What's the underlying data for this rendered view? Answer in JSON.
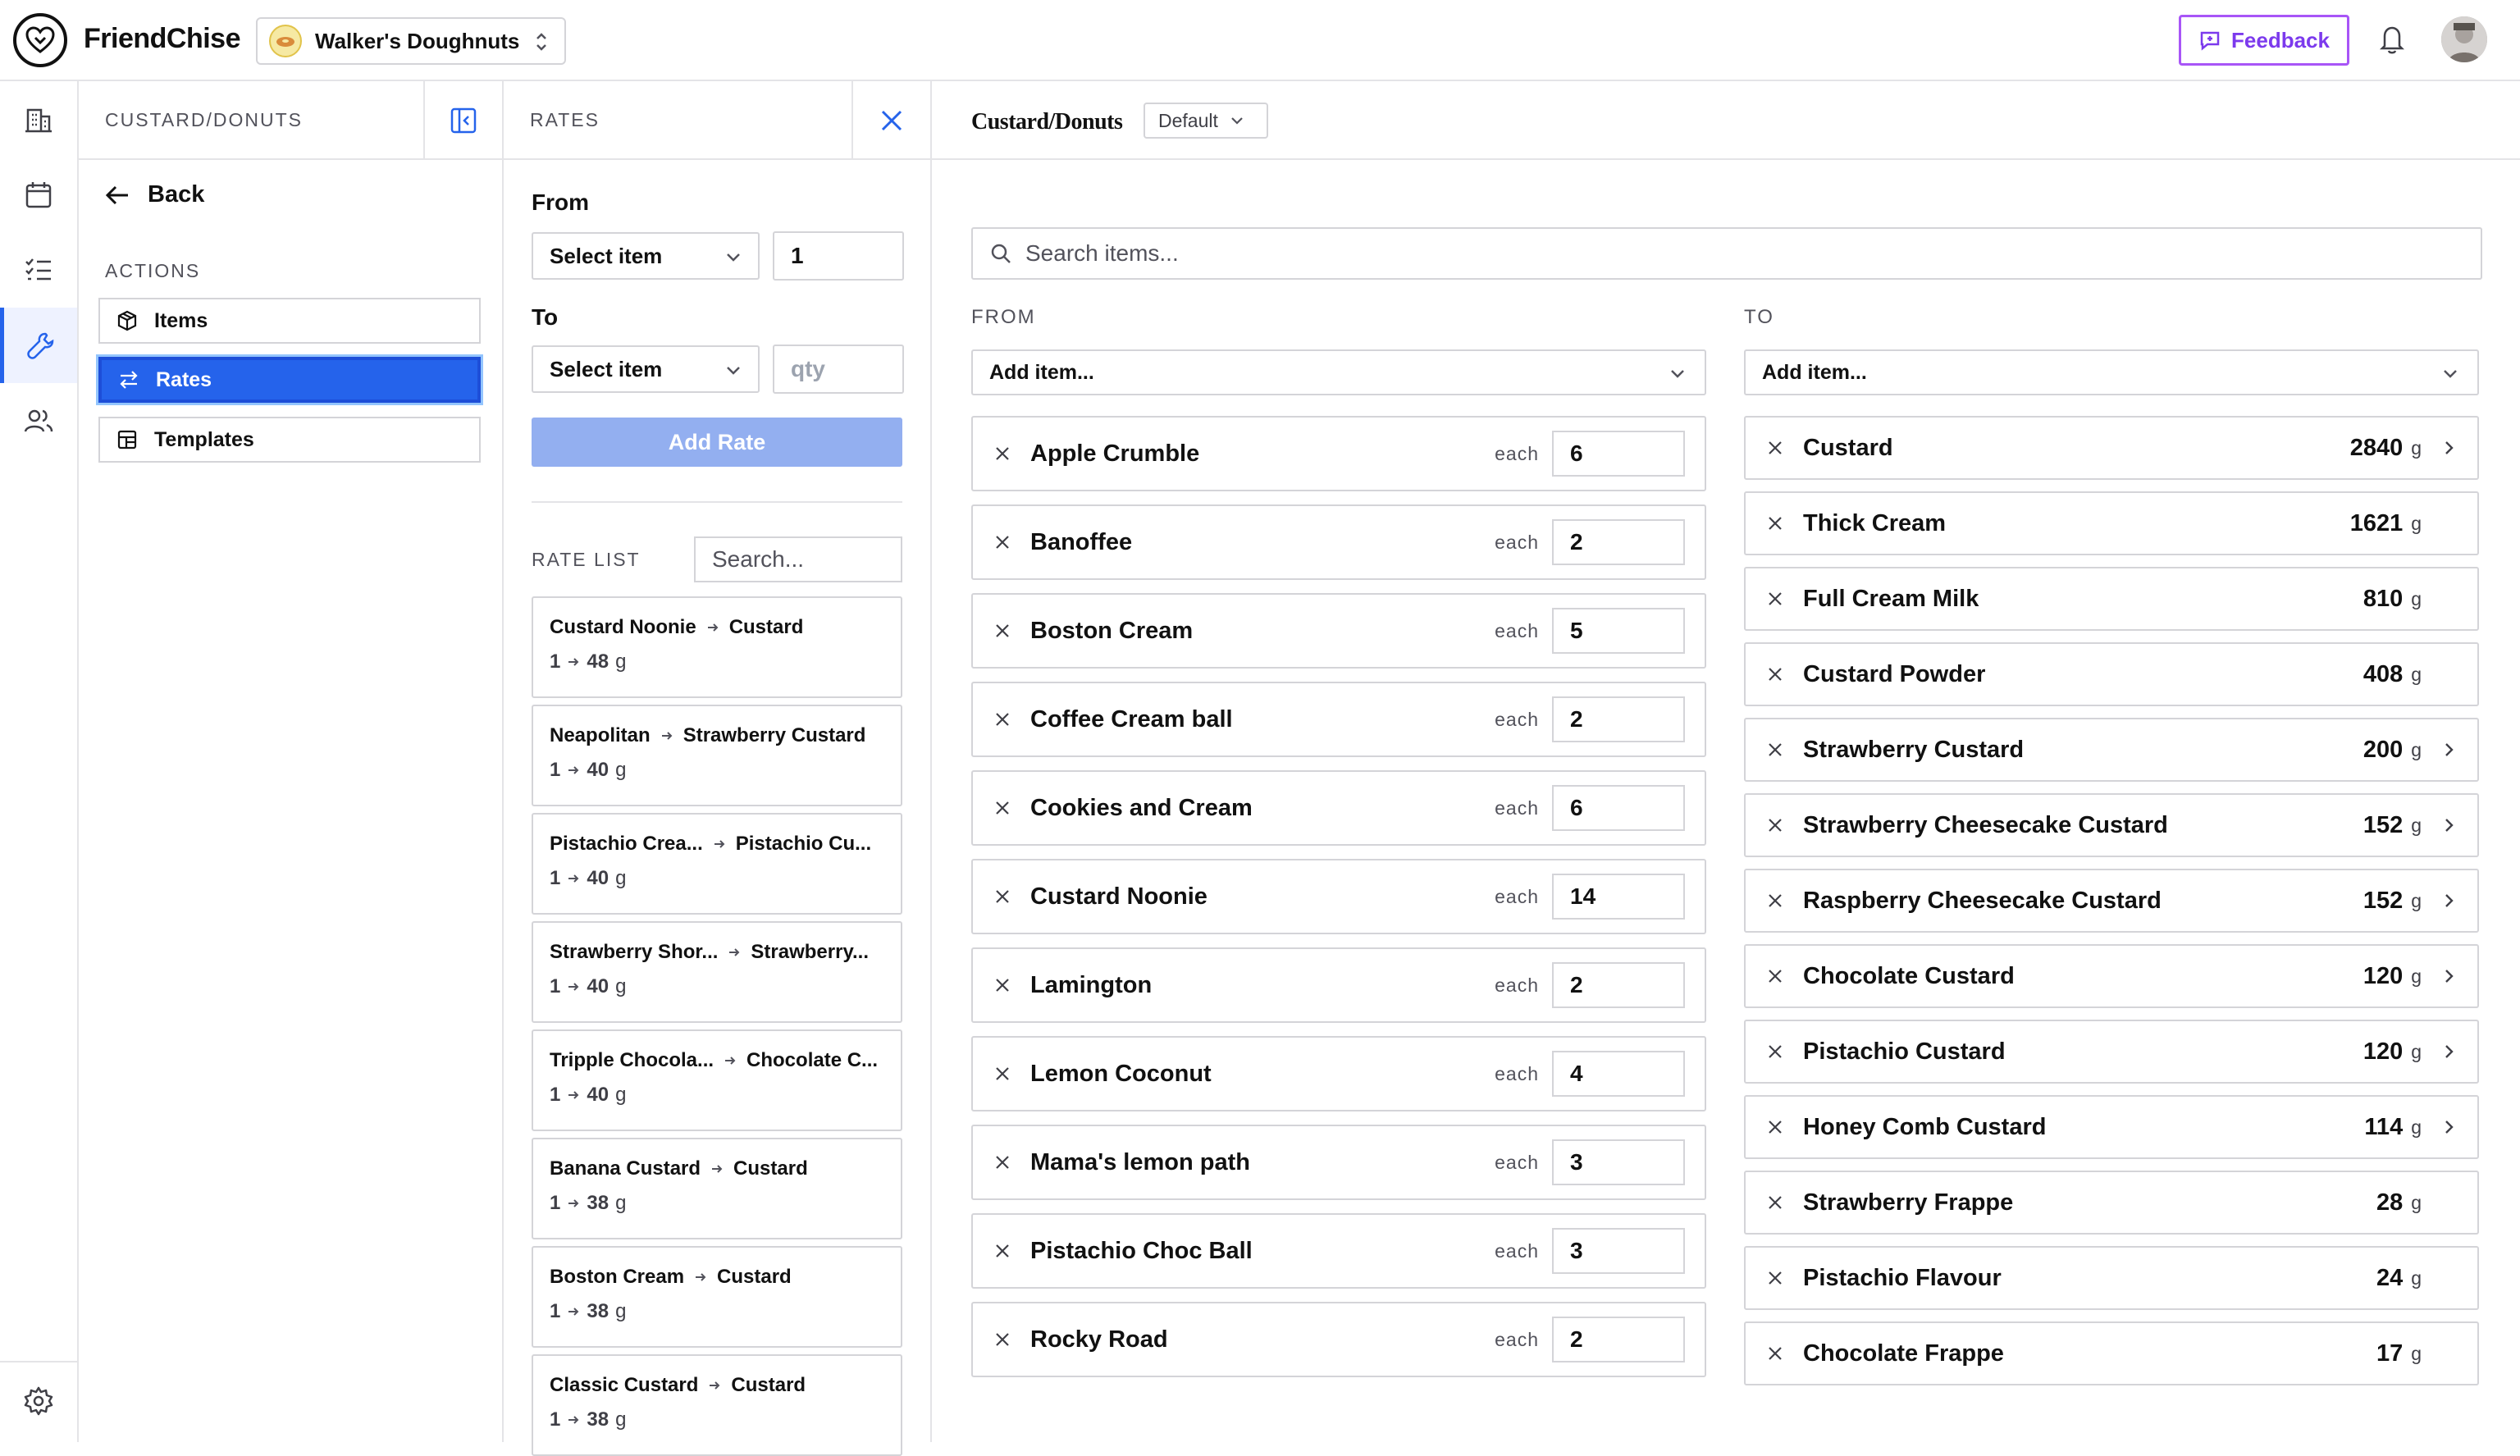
{
  "app": {
    "brand": "FriendChise",
    "store": "Walker's Doughnuts",
    "feedback_label": "Feedback"
  },
  "sidebar": {
    "title": "CUSTARD/DONUTS",
    "back_label": "Back",
    "actions_label": "ACTIONS",
    "actions": [
      {
        "label": "Items",
        "icon": "box-icon",
        "active": false
      },
      {
        "label": "Rates",
        "icon": "swap-icon",
        "active": true
      },
      {
        "label": "Templates",
        "icon": "template-icon",
        "active": false
      }
    ]
  },
  "rates_panel": {
    "title": "RATES",
    "from_label": "From",
    "from_select": "Select item",
    "from_qty": "1",
    "to_label": "To",
    "to_select": "Select item",
    "to_qty_placeholder": "qty",
    "add_rate_label": "Add Rate",
    "rate_list_label": "RATE LIST",
    "rate_search_placeholder": "Search...",
    "rates": [
      {
        "from": "Custard Noonie",
        "to": "Custard",
        "qty": "1",
        "amount": "48",
        "unit": "g"
      },
      {
        "from": "Neapolitan",
        "to": "Strawberry Custard",
        "qty": "1",
        "amount": "40",
        "unit": "g"
      },
      {
        "from": "Pistachio Crea...",
        "to": "Pistachio Cu...",
        "qty": "1",
        "amount": "40",
        "unit": "g"
      },
      {
        "from": "Strawberry Shor...",
        "to": "Strawberry...",
        "qty": "1",
        "amount": "40",
        "unit": "g"
      },
      {
        "from": "Tripple Chocola...",
        "to": "Chocolate C...",
        "qty": "1",
        "amount": "40",
        "unit": "g"
      },
      {
        "from": "Banana Custard",
        "to": "Custard",
        "qty": "1",
        "amount": "38",
        "unit": "g"
      },
      {
        "from": "Boston Cream",
        "to": "Custard",
        "qty": "1",
        "amount": "38",
        "unit": "g"
      },
      {
        "from": "Classic Custard",
        "to": "Custard",
        "qty": "1",
        "amount": "38",
        "unit": "g"
      }
    ]
  },
  "main": {
    "title": "Custard/Donuts",
    "variant": "Default",
    "search_placeholder": "Search items...",
    "from_label": "FROM",
    "to_label": "TO",
    "add_item_placeholder": "Add item...",
    "from_items": [
      {
        "name": "Apple Crumble",
        "unit": "each",
        "qty": "6"
      },
      {
        "name": "Banoffee",
        "unit": "each",
        "qty": "2"
      },
      {
        "name": "Boston Cream",
        "unit": "each",
        "qty": "5"
      },
      {
        "name": "Coffee Cream ball",
        "unit": "each",
        "qty": "2"
      },
      {
        "name": "Cookies and Cream",
        "unit": "each",
        "qty": "6"
      },
      {
        "name": "Custard Noonie",
        "unit": "each",
        "qty": "14"
      },
      {
        "name": "Lamington",
        "unit": "each",
        "qty": "2"
      },
      {
        "name": "Lemon Coconut",
        "unit": "each",
        "qty": "4"
      },
      {
        "name": "Mama's lemon path",
        "unit": "each",
        "qty": "3"
      },
      {
        "name": "Pistachio Choc Ball",
        "unit": "each",
        "qty": "3"
      },
      {
        "name": "Rocky Road",
        "unit": "each",
        "qty": "2"
      }
    ],
    "to_items": [
      {
        "name": "Custard",
        "value": "2840",
        "unit": "g",
        "has_arrow": true
      },
      {
        "name": "Thick Cream",
        "value": "1621",
        "unit": "g",
        "has_arrow": false
      },
      {
        "name": "Full Cream Milk",
        "value": "810",
        "unit": "g",
        "has_arrow": false
      },
      {
        "name": "Custard Powder",
        "value": "408",
        "unit": "g",
        "has_arrow": false
      },
      {
        "name": "Strawberry Custard",
        "value": "200",
        "unit": "g",
        "has_arrow": true
      },
      {
        "name": "Strawberry Cheesecake Custard",
        "value": "152",
        "unit": "g",
        "has_arrow": true
      },
      {
        "name": "Raspberry Cheesecake Custard",
        "value": "152",
        "unit": "g",
        "has_arrow": true
      },
      {
        "name": "Chocolate Custard",
        "value": "120",
        "unit": "g",
        "has_arrow": true
      },
      {
        "name": "Pistachio Custard",
        "value": "120",
        "unit": "g",
        "has_arrow": true
      },
      {
        "name": "Honey Comb Custard",
        "value": "114",
        "unit": "g",
        "has_arrow": true
      },
      {
        "name": "Strawberry Frappe",
        "value": "28",
        "unit": "g",
        "has_arrow": false
      },
      {
        "name": "Pistachio Flavour",
        "value": "24",
        "unit": "g",
        "has_arrow": false
      },
      {
        "name": "Chocolate Frappe",
        "value": "17",
        "unit": "g",
        "has_arrow": false
      }
    ]
  },
  "colors": {
    "accent": "#2563eb",
    "feedback": "#7c3aed",
    "add_rate_disabled": "#93aff0",
    "border": "#d4d4d8"
  }
}
